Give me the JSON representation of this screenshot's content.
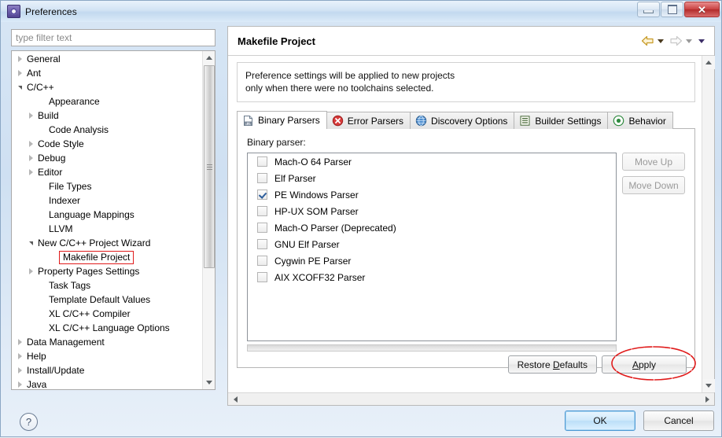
{
  "window": {
    "title": "Preferences",
    "icon": "preferences-gear-icon",
    "controls": {
      "minimize": "Minimize",
      "maximize": "Maximize",
      "close": "Close"
    }
  },
  "filter": {
    "placeholder": "type filter text",
    "value": ""
  },
  "tree": {
    "items": [
      {
        "label": "General",
        "indent": 0,
        "state": "collapsed"
      },
      {
        "label": "Ant",
        "indent": 0,
        "state": "collapsed"
      },
      {
        "label": "C/C++",
        "indent": 0,
        "state": "expanded"
      },
      {
        "label": "Appearance",
        "indent": 2,
        "state": "leaf"
      },
      {
        "label": "Build",
        "indent": 1,
        "state": "collapsed"
      },
      {
        "label": "Code Analysis",
        "indent": 2,
        "state": "leaf"
      },
      {
        "label": "Code Style",
        "indent": 1,
        "state": "collapsed"
      },
      {
        "label": "Debug",
        "indent": 1,
        "state": "collapsed"
      },
      {
        "label": "Editor",
        "indent": 1,
        "state": "collapsed"
      },
      {
        "label": "File Types",
        "indent": 2,
        "state": "leaf"
      },
      {
        "label": "Indexer",
        "indent": 2,
        "state": "leaf"
      },
      {
        "label": "Language Mappings",
        "indent": 2,
        "state": "leaf"
      },
      {
        "label": "LLVM",
        "indent": 2,
        "state": "leaf"
      },
      {
        "label": "New C/C++ Project Wizard",
        "indent": 1,
        "state": "expanded"
      },
      {
        "label": "Makefile Project",
        "indent": 3,
        "state": "leaf",
        "highlight": true
      },
      {
        "label": "Property Pages Settings",
        "indent": 1,
        "state": "collapsed"
      },
      {
        "label": "Task Tags",
        "indent": 2,
        "state": "leaf"
      },
      {
        "label": "Template Default Values",
        "indent": 2,
        "state": "leaf"
      },
      {
        "label": "XL C/C++ Compiler",
        "indent": 2,
        "state": "leaf"
      },
      {
        "label": "XL C/C++ Language Options",
        "indent": 2,
        "state": "leaf"
      },
      {
        "label": "Data Management",
        "indent": 0,
        "state": "collapsed"
      },
      {
        "label": "Help",
        "indent": 0,
        "state": "collapsed"
      },
      {
        "label": "Install/Update",
        "indent": 0,
        "state": "collapsed"
      },
      {
        "label": "Java",
        "indent": 0,
        "state": "collapsed"
      }
    ]
  },
  "page": {
    "title": "Makefile Project",
    "description_line1": "Preference settings will be applied to new projects",
    "description_line2": "only when there were no toolchains selected.",
    "nav": {
      "back": "back-arrow-icon",
      "forward": "forward-arrow-icon",
      "menu": "view-menu-icon"
    }
  },
  "tabs": [
    {
      "label": "Binary Parsers",
      "icon": "binary-file-icon",
      "active": true
    },
    {
      "label": "Error Parsers",
      "icon": "error-x-icon",
      "active": false
    },
    {
      "label": "Discovery Options",
      "icon": "globe-icon",
      "active": false
    },
    {
      "label": "Builder Settings",
      "icon": "list-lines-icon",
      "active": false
    },
    {
      "label": "Behavior",
      "icon": "target-circle-icon",
      "active": false
    }
  ],
  "binary_parsers": {
    "group_label": "Binary parser:",
    "items": [
      {
        "label": "Mach-O 64 Parser",
        "checked": false
      },
      {
        "label": "Elf Parser",
        "checked": false
      },
      {
        "label": "PE Windows Parser",
        "checked": true
      },
      {
        "label": "HP-UX SOM Parser",
        "checked": false
      },
      {
        "label": "Mach-O Parser (Deprecated)",
        "checked": false
      },
      {
        "label": "GNU Elf Parser",
        "checked": false
      },
      {
        "label": "Cygwin PE Parser",
        "checked": false
      },
      {
        "label": "AIX XCOFF32 Parser",
        "checked": false
      }
    ],
    "move_up": "Move Up",
    "move_down": "Move Down"
  },
  "actions": {
    "restore_defaults_pre": "Restore ",
    "restore_defaults_key": "D",
    "restore_defaults_post": "efaults",
    "apply_key": "A",
    "apply_post": "pply"
  },
  "footer": {
    "help": "?",
    "ok": "OK",
    "cancel": "Cancel"
  },
  "annotation": {
    "shape": "red-ellipse",
    "color": "#e01b1b",
    "target": "Apply"
  }
}
